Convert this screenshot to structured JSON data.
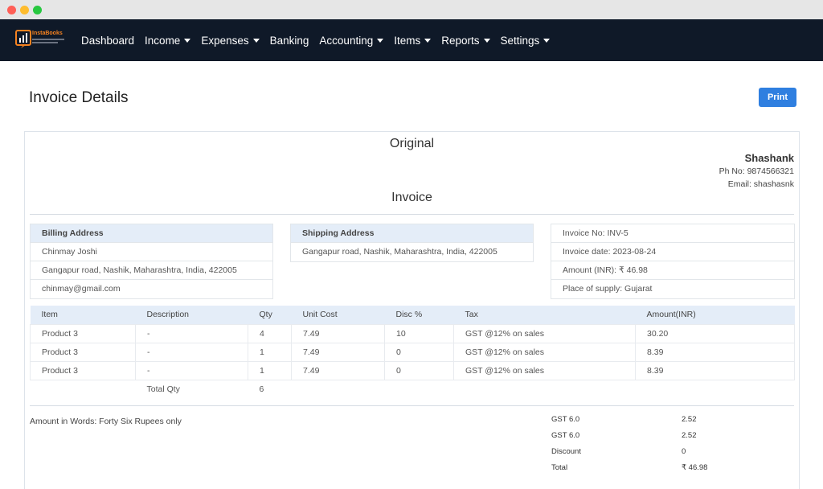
{
  "nav": {
    "logo_text": "InstaBooks",
    "items": [
      {
        "label": "Dashboard",
        "dropdown": false
      },
      {
        "label": "Income",
        "dropdown": true
      },
      {
        "label": "Expenses",
        "dropdown": true
      },
      {
        "label": "Banking",
        "dropdown": false
      },
      {
        "label": "Accounting",
        "dropdown": true
      },
      {
        "label": "Items",
        "dropdown": true
      },
      {
        "label": "Reports",
        "dropdown": true
      },
      {
        "label": "Settings",
        "dropdown": true
      }
    ]
  },
  "page": {
    "title": "Invoice Details",
    "print_label": "Print"
  },
  "invoice": {
    "copy_label": "Original",
    "company": {
      "name": "Shashank",
      "phone": "Ph No: 9874566321",
      "email": "Email: shashasnk"
    },
    "doc_title": "Invoice",
    "billing": {
      "heading": "Billing Address",
      "name": "Chinmay Joshi",
      "address": "Gangapur road, Nashik, Maharashtra, India, 422005",
      "email": "chinmay@gmail.com"
    },
    "shipping": {
      "heading": "Shipping Address",
      "address": "Gangapur road, Nashik, Maharashtra, India, 422005"
    },
    "meta": {
      "invoice_no": "Invoice No: INV-5",
      "invoice_date": "Invoice date: 2023-08-24",
      "amount": "Amount (INR): ₹ 46.98",
      "place_of_supply": "Place of supply: Gujarat"
    },
    "table": {
      "headers": [
        "Item",
        "Description",
        "Qty",
        "Unit Cost",
        "Disc %",
        "Tax",
        "Amount(INR)"
      ],
      "rows": [
        [
          "Product 3",
          "-",
          "4",
          "7.49",
          "10",
          "GST @12% on sales",
          "30.20"
        ],
        [
          "Product 3",
          "-",
          "1",
          "7.49",
          "0",
          "GST @12% on sales",
          "8.39"
        ],
        [
          "Product 3",
          "-",
          "1",
          "7.49",
          "0",
          "GST @12% on sales",
          "8.39"
        ]
      ],
      "total_qty_label": "Total Qty",
      "total_qty_value": "6"
    },
    "amount_in_words": "Amount in Words:  Forty Six Rupees only",
    "summary": [
      {
        "label": "GST 6.0",
        "value": "2.52"
      },
      {
        "label": "GST 6.0",
        "value": "2.52"
      },
      {
        "label": "Discount",
        "value": "0"
      },
      {
        "label": "Total",
        "value": "₹ 46.98"
      }
    ]
  },
  "colors": {
    "navbar": "#0f1928",
    "accent": "#2f7fe0",
    "table_header": "#e4edf8",
    "logo_orange": "#f58220"
  }
}
